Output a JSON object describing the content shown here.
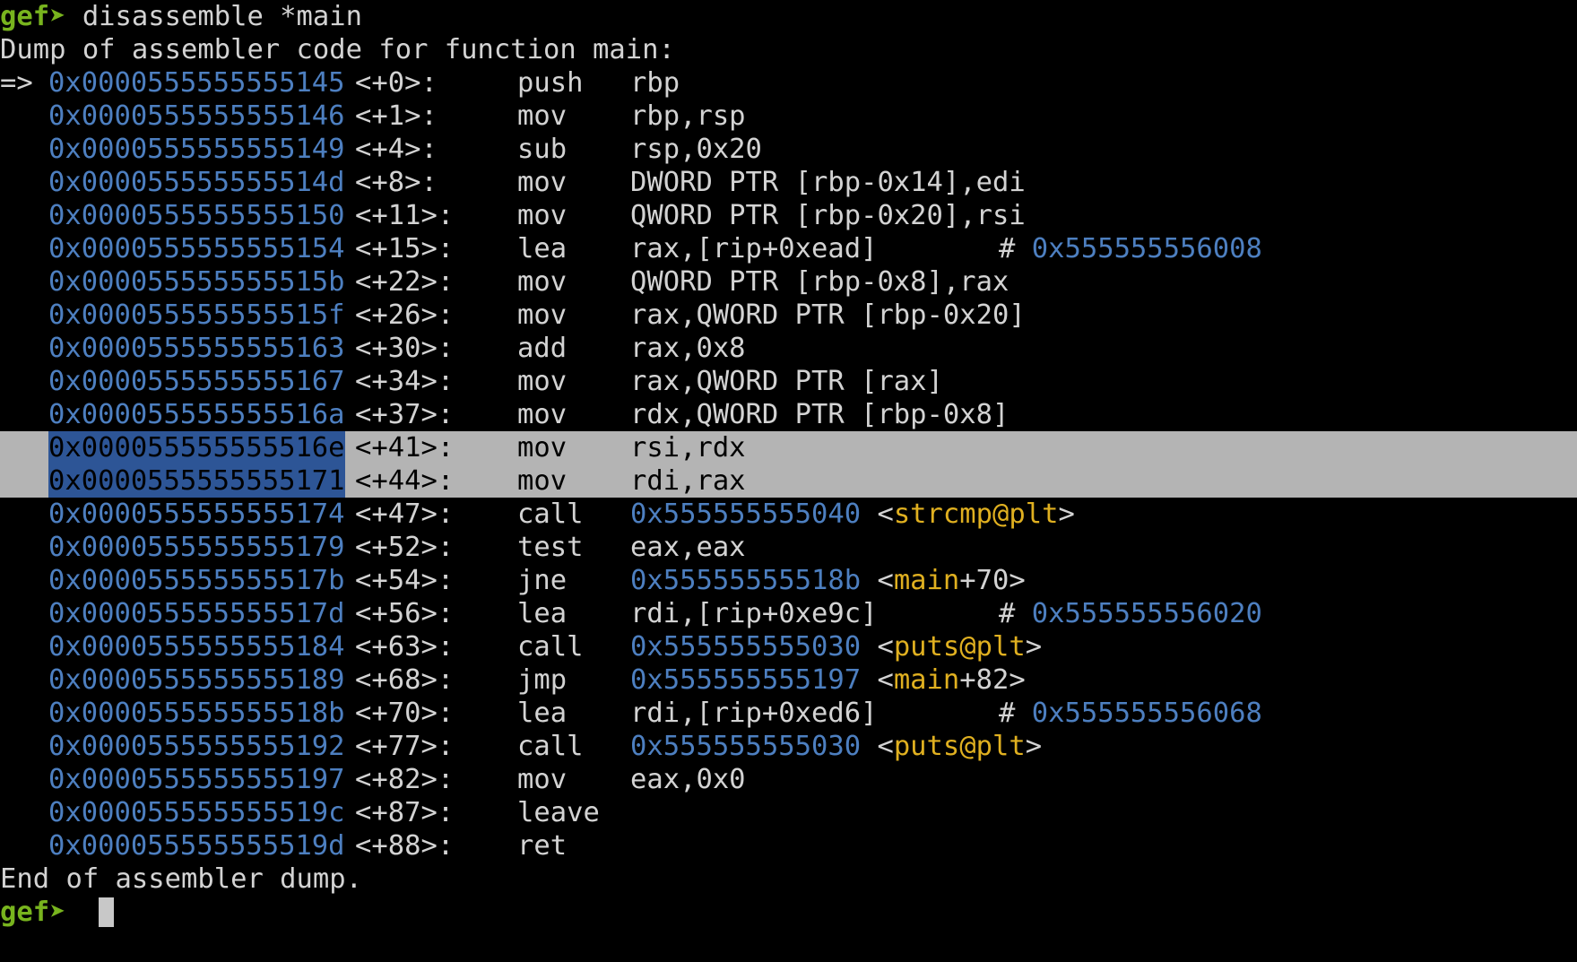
{
  "prompt": "gef➤",
  "command": " disassemble *main",
  "header": "Dump of assembler code for function main:",
  "footer": "End of assembler dump.",
  "current_marker": "=>",
  "colors": {
    "background": "#000000",
    "prompt": "#78b41e",
    "address": "#4d7fc0",
    "symbol": "#e0b020",
    "text": "#d3d3d3",
    "selection": "#b4b4b4",
    "address_selection": "#2d5596"
  },
  "instructions": [
    {
      "addr": "0x0000555555555145",
      "off": "<+0>:",
      "mn": "push",
      "op": "rbp"
    },
    {
      "addr": "0x0000555555555146",
      "off": "<+1>:",
      "mn": "mov",
      "op": "rbp,rsp"
    },
    {
      "addr": "0x0000555555555149",
      "off": "<+4>:",
      "mn": "sub",
      "op": "rsp,0x20"
    },
    {
      "addr": "0x000055555555514d",
      "off": "<+8>:",
      "mn": "mov",
      "op": "DWORD PTR [rbp-0x14],edi"
    },
    {
      "addr": "0x0000555555555150",
      "off": "<+11>:",
      "mn": "mov",
      "op": "QWORD PTR [rbp-0x20],rsi"
    },
    {
      "addr": "0x0000555555555154",
      "off": "<+15>:",
      "mn": "lea",
      "op": "rax,[rip+0xead]",
      "comment_hash": "#",
      "comment_addr": "0x555555556008"
    },
    {
      "addr": "0x000055555555515b",
      "off": "<+22>:",
      "mn": "mov",
      "op": "QWORD PTR [rbp-0x8],rax"
    },
    {
      "addr": "0x000055555555515f",
      "off": "<+26>:",
      "mn": "mov",
      "op": "rax,QWORD PTR [rbp-0x20]"
    },
    {
      "addr": "0x0000555555555163",
      "off": "<+30>:",
      "mn": "add",
      "op": "rax,0x8"
    },
    {
      "addr": "0x0000555555555167",
      "off": "<+34>:",
      "mn": "mov",
      "op": "rax,QWORD PTR [rax]"
    },
    {
      "addr": "0x000055555555516a",
      "off": "<+37>:",
      "mn": "mov",
      "op": "rdx,QWORD PTR [rbp-0x8]"
    },
    {
      "addr": "0x000055555555516e",
      "off": "<+41>:",
      "mn": "mov",
      "op": "rsi,rdx"
    },
    {
      "addr": "0x0000555555555171",
      "off": "<+44>:",
      "mn": "mov",
      "op": "rdi,rax"
    },
    {
      "addr": "0x0000555555555174",
      "off": "<+47>:",
      "mn": "call",
      "target": "0x555555555040",
      "sym_name": "strcmp@plt"
    },
    {
      "addr": "0x0000555555555179",
      "off": "<+52>:",
      "mn": "test",
      "op": "eax,eax"
    },
    {
      "addr": "0x000055555555517b",
      "off": "<+54>:",
      "mn": "jne",
      "target": "0x55555555518b",
      "sym_name": "main",
      "sym_off": "+70"
    },
    {
      "addr": "0x000055555555517d",
      "off": "<+56>:",
      "mn": "lea",
      "op": "rdi,[rip+0xe9c]",
      "comment_hash": "#",
      "comment_addr": "0x555555556020"
    },
    {
      "addr": "0x0000555555555184",
      "off": "<+63>:",
      "mn": "call",
      "target": "0x555555555030",
      "sym_name": "puts@plt"
    },
    {
      "addr": "0x0000555555555189",
      "off": "<+68>:",
      "mn": "jmp",
      "target": "0x555555555197",
      "sym_name": "main",
      "sym_off": "+82"
    },
    {
      "addr": "0x000055555555518b",
      "off": "<+70>:",
      "mn": "lea",
      "op": "rdi,[rip+0xed6]",
      "comment_hash": "#",
      "comment_addr": "0x555555556068"
    },
    {
      "addr": "0x0000555555555192",
      "off": "<+77>:",
      "mn": "call",
      "target": "0x555555555030",
      "sym_name": "puts@plt"
    },
    {
      "addr": "0x0000555555555197",
      "off": "<+82>:",
      "mn": "mov",
      "op": "eax,0x0"
    },
    {
      "addr": "0x000055555555519c",
      "off": "<+87>:",
      "mn": "leave"
    },
    {
      "addr": "0x000055555555519d",
      "off": "<+88>:",
      "mn": "ret"
    }
  ]
}
